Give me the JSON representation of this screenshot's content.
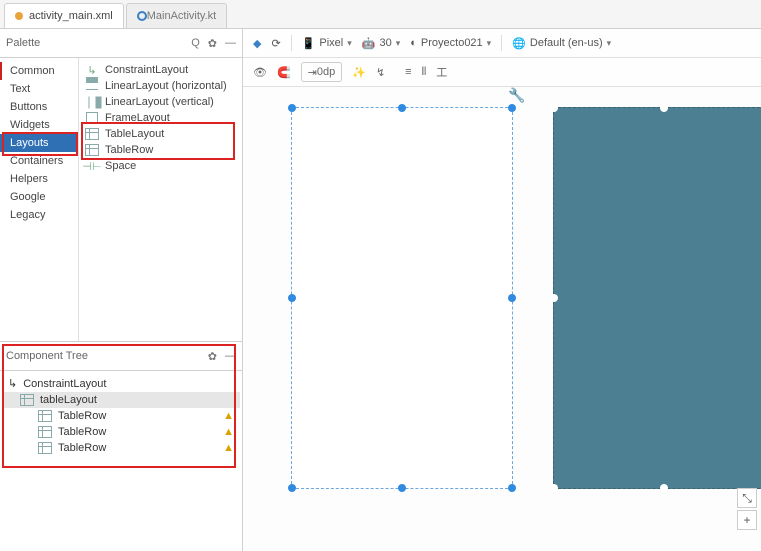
{
  "tabs": {
    "active": "activity_main.xml",
    "inactive": "MainActivity.kt"
  },
  "palette": {
    "title": "Palette",
    "categories": [
      "Common",
      "Text",
      "Buttons",
      "Widgets",
      "Layouts",
      "Containers",
      "Helpers",
      "Google",
      "Legacy"
    ],
    "selected": "Layouts",
    "items": [
      "ConstraintLayout",
      "LinearLayout (horizontal)",
      "LinearLayout (vertical)",
      "FrameLayout",
      "TableLayout",
      "TableRow",
      "Space"
    ]
  },
  "componentTree": {
    "title": "Component Tree",
    "root": "ConstraintLayout",
    "child": "tableLayout",
    "rows": [
      "TableRow",
      "TableRow",
      "TableRow"
    ]
  },
  "toolbar": {
    "device": "Pixel",
    "api": "30",
    "project": "Proyecto021",
    "locale": "Default (en-us)",
    "dp": "0dp"
  }
}
